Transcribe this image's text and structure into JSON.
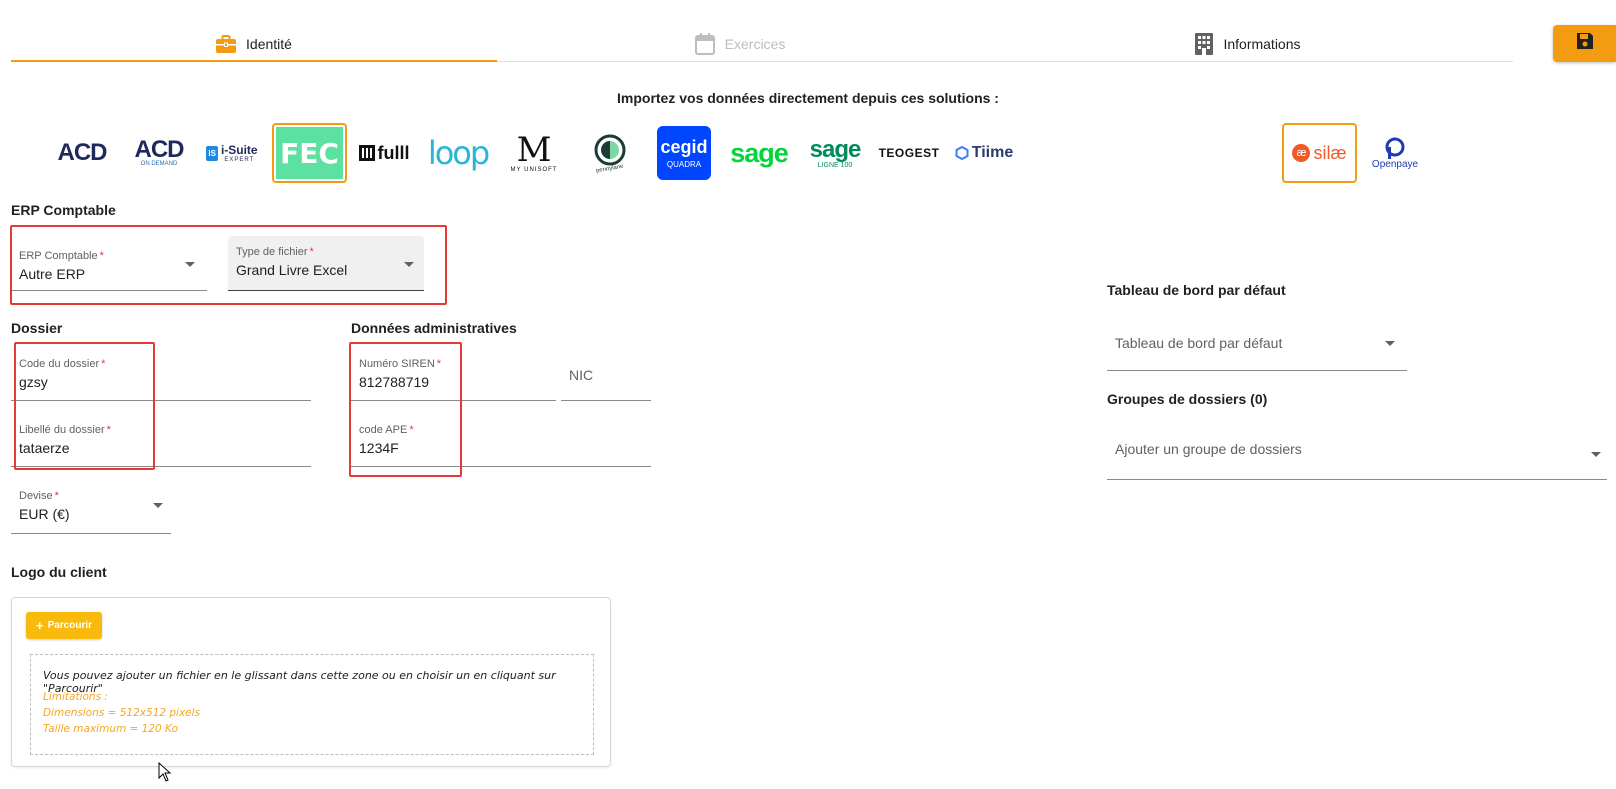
{
  "tabs": [
    {
      "label": "Identité",
      "icon": "briefcase-icon",
      "state": "active"
    },
    {
      "label": "Exercices",
      "icon": "calendar-icon",
      "state": "disabled"
    },
    {
      "label": "Informations",
      "icon": "building-icon",
      "state": "normal"
    }
  ],
  "toolbar": {
    "save_icon": "floppy-disk-icon"
  },
  "colors": {
    "accent": "#f39c12",
    "required": "#e53935",
    "highlight_box": "#e53935",
    "browse_button": "#f9b90d",
    "limitations_text": "#f5a623"
  },
  "import": {
    "title": "Importez vos données directement depuis ces solutions :",
    "logos": [
      {
        "text": "ACD"
      },
      {
        "text": "ACD",
        "sub": "ON DEMAND"
      },
      {
        "text": "i-Suite",
        "sub": "EXPERT",
        "badge": "IS"
      },
      {
        "text": "FEC",
        "selected": true
      },
      {
        "text": "fulll"
      },
      {
        "text": "loop"
      },
      {
        "text": "M",
        "sub": "MY UNISOFT"
      },
      {
        "text": "pennylane"
      },
      {
        "text": "cegid",
        "sub": "QUADRA"
      },
      {
        "text": "sage"
      },
      {
        "text": "sage",
        "sub": "LIGNE 100"
      },
      {
        "text": "TEOGEST"
      },
      {
        "text": "Tiime"
      }
    ],
    "payroll_logos": [
      {
        "text": "silæ",
        "badge": "æ",
        "selected": true
      },
      {
        "text": "Openpaye"
      }
    ]
  },
  "erp": {
    "section_title": "ERP Comptable",
    "erp_field": {
      "label": "ERP Comptable",
      "required_mark": "*",
      "value": "Autre ERP"
    },
    "file_type_field": {
      "label": "Type de fichier",
      "required_mark": "*",
      "value": "Grand Livre Excel"
    }
  },
  "dossier": {
    "section_title": "Dossier",
    "code": {
      "label": "Code du dossier",
      "required_mark": "*",
      "value": "gzsy"
    },
    "libelle": {
      "label": "Libellé du dossier",
      "required_mark": "*",
      "value": "tataerze"
    },
    "devise": {
      "label": "Devise",
      "required_mark": "*",
      "value": "EUR (€)"
    }
  },
  "admin": {
    "section_title": "Données administratives",
    "siren": {
      "label": "Numéro SIREN",
      "required_mark": "*",
      "value": "812788719"
    },
    "nic": {
      "placeholder": "NIC"
    },
    "ape": {
      "label": "code APE",
      "required_mark": "*",
      "value": "1234F"
    }
  },
  "dashboard": {
    "section_title": "Tableau de bord par défaut",
    "select_placeholder": "Tableau de bord par défaut"
  },
  "groups": {
    "section_title": "Groupes de dossiers (0)",
    "select_placeholder": "Ajouter un groupe de dossiers"
  },
  "logo_client": {
    "section_title": "Logo du client",
    "browse_label": "Parcourir",
    "dropzone_text": "Vous pouvez ajouter un fichier en le glissant dans cette zone ou en choisir un en cliquant sur \"Parcourir\"",
    "limitations_title": "Limitations :",
    "limitations": [
      "Dimensions = 512x512 pixels",
      "Taille maximum = 120 Ko"
    ]
  }
}
